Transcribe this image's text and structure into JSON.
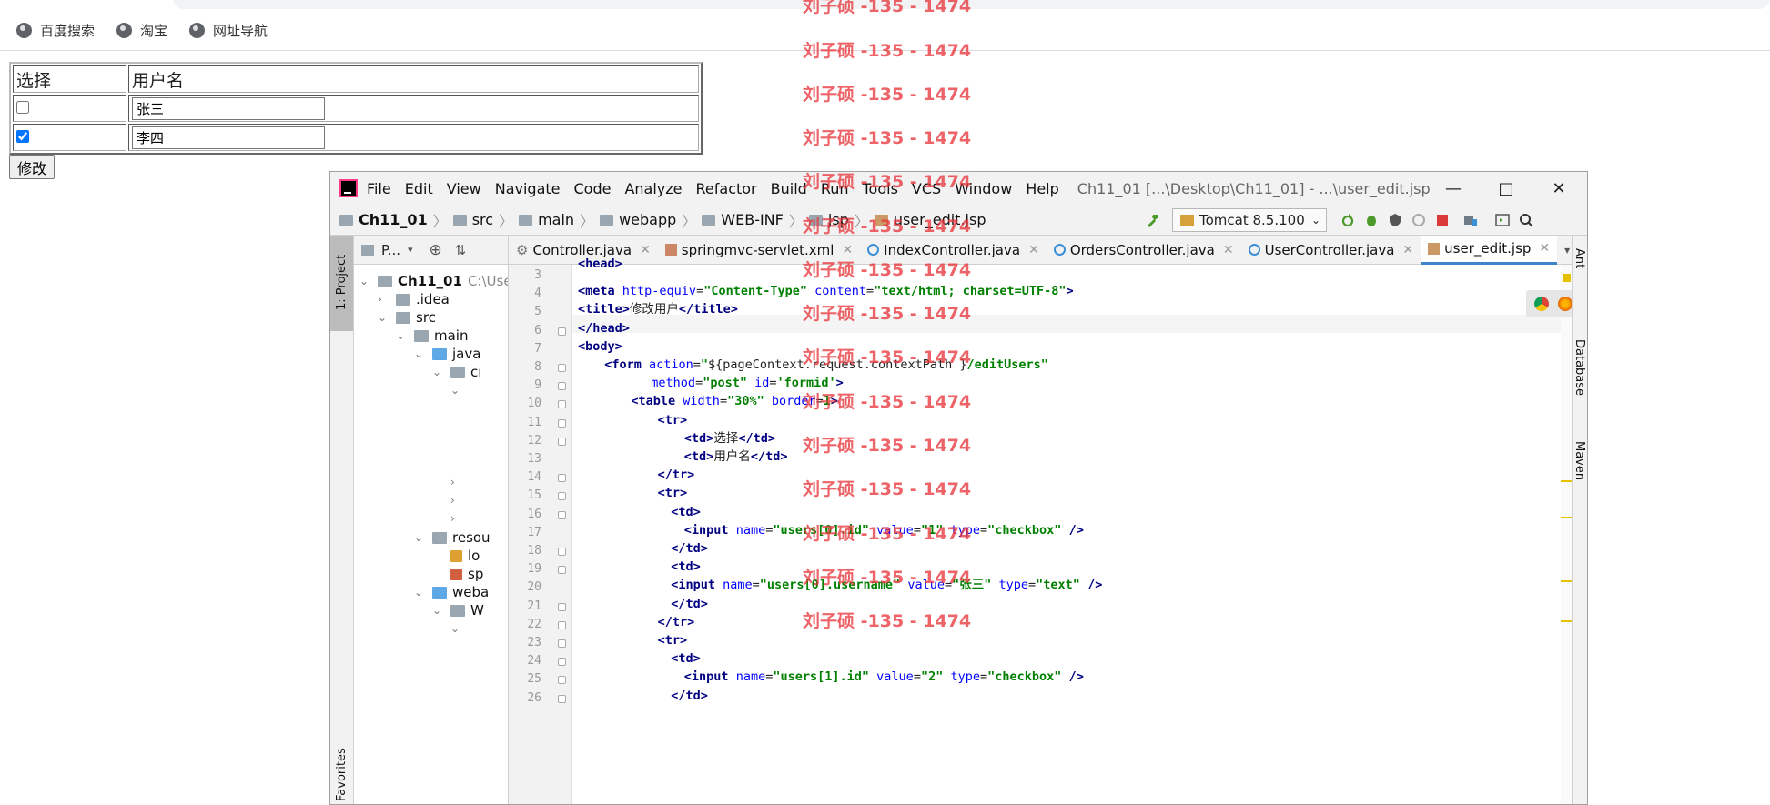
{
  "browser": {
    "bookmarks": [
      "百度搜索",
      "淘宝",
      "网址导航"
    ]
  },
  "page": {
    "table": {
      "headers": [
        "选择",
        "用户名"
      ],
      "rows": [
        {
          "checked": false,
          "username": "张三"
        },
        {
          "checked": true,
          "username": "李四"
        }
      ]
    },
    "submit_label": "修改"
  },
  "ide": {
    "menu": [
      "File",
      "Edit",
      "View",
      "Navigate",
      "Code",
      "Analyze",
      "Refactor",
      "Build",
      "Run",
      "Tools",
      "VCS",
      "Window",
      "Help"
    ],
    "title": "Ch11_01 [...\\Desktop\\Ch11_01] - ...\\user_edit.jsp",
    "window_controls": [
      "minimize",
      "maximize",
      "close"
    ],
    "breadcrumb": [
      "Ch11_01",
      "src",
      "main",
      "webapp",
      "WEB-INF",
      "jsp",
      "user_edit.jsp"
    ],
    "run_config": "Tomcat 8.5.100",
    "project_panel_title": "P...",
    "left_tool_tabs": [
      "1: Project",
      "Favorites"
    ],
    "right_tool_tabs": [
      "Ant",
      "Database",
      "Maven"
    ],
    "tree": [
      {
        "label": "Ch11_01",
        "extra": "C:\\Use"
      },
      {
        "label": ".idea"
      },
      {
        "label": "src"
      },
      {
        "label": "main"
      },
      {
        "label": "java"
      },
      {
        "label": "cı"
      },
      {
        "label": "resou"
      },
      {
        "label": "lo"
      },
      {
        "label": "sp"
      },
      {
        "label": "weba"
      },
      {
        "label": "W"
      }
    ],
    "tabs": [
      {
        "label": "Controller.java",
        "active": false
      },
      {
        "label": "springmvc-servlet.xml",
        "active": false
      },
      {
        "label": "IndexController.java",
        "active": false
      },
      {
        "label": "OrdersController.java",
        "active": false
      },
      {
        "label": "UserController.java",
        "active": false
      },
      {
        "label": "user_edit.jsp",
        "active": true
      }
    ],
    "tab_overflow": "1",
    "line_numbers": [
      "3",
      "4",
      "5",
      "6",
      "7",
      "8",
      "9",
      "10",
      "11",
      "12",
      "13",
      "14",
      "15",
      "16",
      "17",
      "18",
      "19",
      "20",
      "21",
      "22",
      "23",
      "24",
      "25",
      "26"
    ],
    "browser_icons": [
      "chrome-icon",
      "firefox-icon",
      "safari-icon",
      "opera-icon",
      "ie-icon",
      "edge-icon"
    ]
  },
  "watermark": "刘子硕 -135 - 1474",
  "colors": {
    "tag": "#000080",
    "attribute": "#0000ff",
    "value": "#008000",
    "watermark": "#e8383d",
    "active_tab_underline": "#4083c9"
  }
}
